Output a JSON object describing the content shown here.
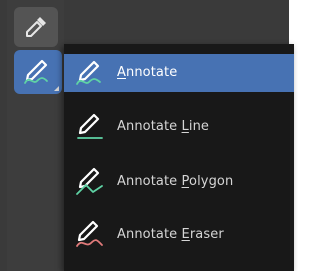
{
  "toolbar": {
    "tools": [
      {
        "name": "Eyedropper",
        "icon": "eyedropper-icon",
        "active": false
      },
      {
        "name": "Annotate",
        "icon": "annotate-icon",
        "active": true
      }
    ]
  },
  "menu": {
    "items": [
      {
        "pre": "",
        "ul": "A",
        "post": "nnotate",
        "icon": "annotate-icon",
        "active": true,
        "stroke_color": "#5fd3a5"
      },
      {
        "pre": "Annotate ",
        "ul": "L",
        "post": "ine",
        "icon": "annotate-line-icon",
        "active": false,
        "stroke_color": "#5fd3a5"
      },
      {
        "pre": "Annotate ",
        "ul": "P",
        "post": "olygon",
        "icon": "annotate-polygon-icon",
        "active": false,
        "stroke_color": "#5fd3a5"
      },
      {
        "pre": "Annotate ",
        "ul": "E",
        "post": "raser",
        "icon": "annotate-eraser-icon",
        "active": false,
        "stroke_color": "#e07a7a"
      }
    ]
  },
  "colors": {
    "accent": "#4772b3",
    "menu_bg": "#181818",
    "toolbar_bg": "#3d3d3d",
    "text": "#d5d5d5"
  }
}
